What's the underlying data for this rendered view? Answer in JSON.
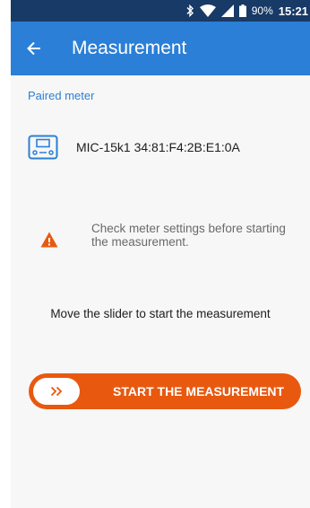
{
  "status_bar": {
    "battery": "90%",
    "time": "15:21",
    "icons": [
      "bluetooth-icon",
      "wifi-icon",
      "signal-icon",
      "battery-icon"
    ]
  },
  "app_bar": {
    "title": "Measurement",
    "back_icon": "arrow-left-icon"
  },
  "paired_meter": {
    "section_label": "Paired meter",
    "icon": "meter-device-icon",
    "name": "MIC-15k1 34:81:F4:2B:E1:0A"
  },
  "warning": {
    "icon": "warning-triangle-icon",
    "text": "Check meter settings before starting the measurement."
  },
  "instruction": "Move the slider to start the measurement",
  "slider": {
    "handle_icon": "double-chevron-right-icon",
    "label": "START THE MEASUREMENT"
  },
  "colors": {
    "status_bar": "#173a66",
    "app_bar": "#2b7fd6",
    "accent": "#e8590f",
    "background": "#f7f7f7"
  }
}
